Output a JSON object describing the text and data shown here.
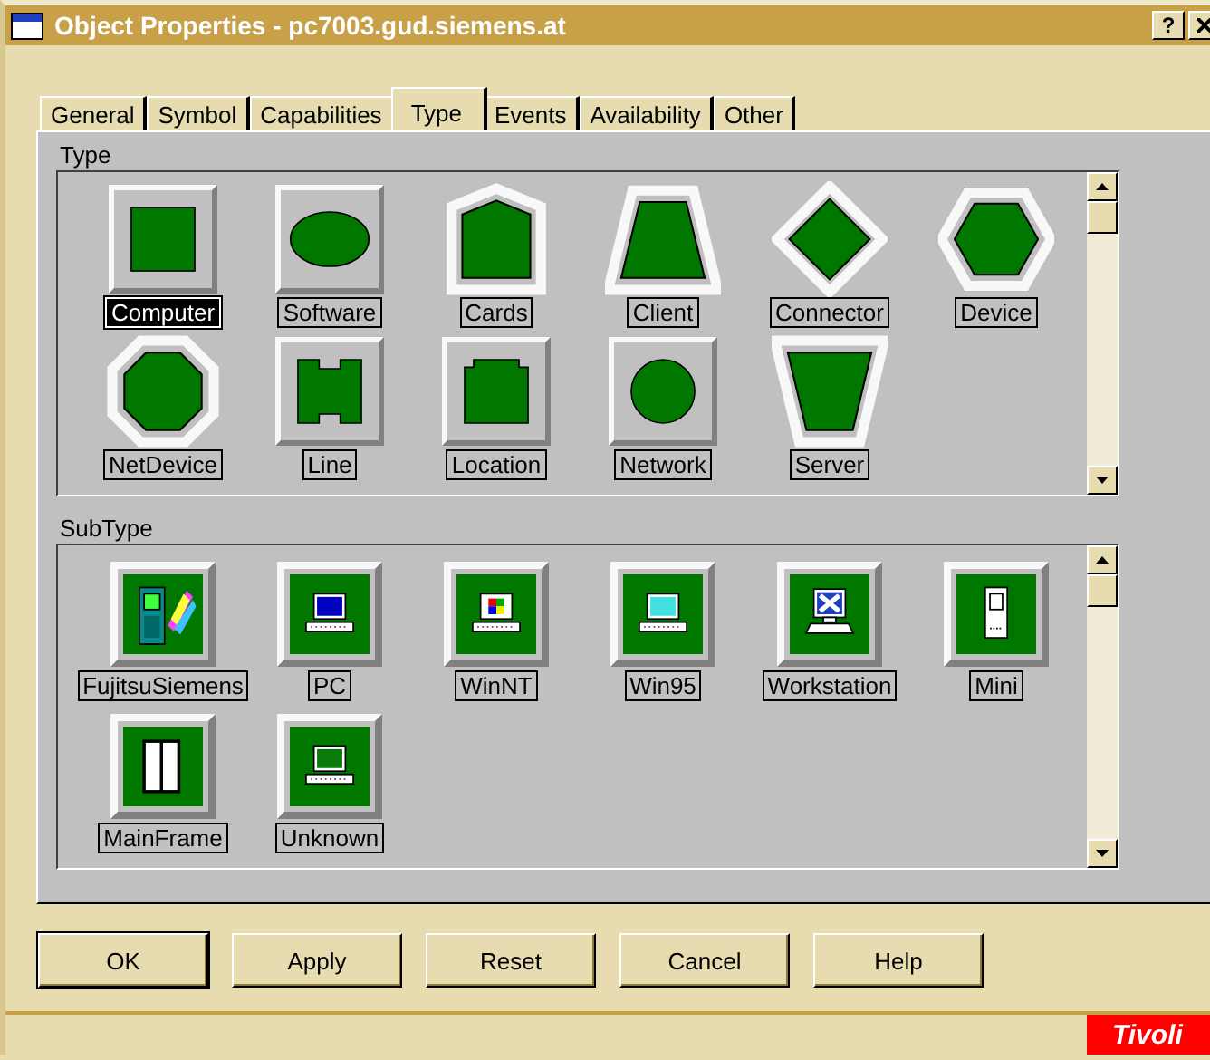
{
  "window": {
    "title": "Object Properties - pc7003.gud.siemens.at",
    "help_button": "?"
  },
  "tabs": [
    {
      "label": "General",
      "selected": false
    },
    {
      "label": "Symbol",
      "selected": false
    },
    {
      "label": "Capabilities",
      "selected": false
    },
    {
      "label": "Type",
      "selected": true
    },
    {
      "label": "Events",
      "selected": false
    },
    {
      "label": "Availability",
      "selected": false
    },
    {
      "label": "Other",
      "selected": false
    }
  ],
  "type_section": {
    "label": "Type",
    "items": [
      {
        "label": "Computer",
        "kind": "square",
        "selected": true
      },
      {
        "label": "Software",
        "kind": "ellipse",
        "selected": false
      },
      {
        "label": "Cards",
        "kind": "pentagon",
        "selected": false
      },
      {
        "label": "Client",
        "kind": "trapezoid",
        "selected": false
      },
      {
        "label": "Connector",
        "kind": "diamond",
        "selected": false
      },
      {
        "label": "Device",
        "kind": "hexagon",
        "selected": false
      },
      {
        "label": "NetDevice",
        "kind": "octagon",
        "selected": false
      },
      {
        "label": "Line",
        "kind": "notched",
        "selected": false
      },
      {
        "label": "Location",
        "kind": "stepped",
        "selected": false
      },
      {
        "label": "Network",
        "kind": "circle",
        "selected": false
      },
      {
        "label": "Server",
        "kind": "funnel",
        "selected": false
      }
    ]
  },
  "subtype_section": {
    "label": "SubType",
    "items": [
      {
        "label": "FujitsuSiemens",
        "kind": "handheld",
        "selected": false
      },
      {
        "label": "PC",
        "kind": "pc",
        "selected": false
      },
      {
        "label": "WinNT",
        "kind": "winnt",
        "selected": false
      },
      {
        "label": "Win95",
        "kind": "win95",
        "selected": false
      },
      {
        "label": "Workstation",
        "kind": "workstation",
        "selected": false
      },
      {
        "label": "Mini",
        "kind": "mini",
        "selected": false
      },
      {
        "label": "MainFrame",
        "kind": "mainframe",
        "selected": false
      },
      {
        "label": "Unknown",
        "kind": "unknown",
        "selected": false
      }
    ]
  },
  "buttons": [
    {
      "label": "OK",
      "default": true
    },
    {
      "label": "Apply",
      "default": false
    },
    {
      "label": "Reset",
      "default": false
    },
    {
      "label": "Cancel",
      "default": false
    },
    {
      "label": "Help",
      "default": false
    }
  ],
  "status_bar": {
    "brand": "Tivoli"
  }
}
